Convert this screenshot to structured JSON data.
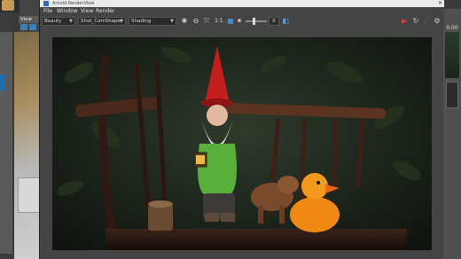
{
  "window": {
    "title": "Arnold RenderView",
    "close_glyph": "✕"
  },
  "side_panel": {
    "tab_label": "View",
    "right_value": "0.00"
  },
  "menu": {
    "items": [
      "File",
      "Window",
      "View",
      "Render"
    ]
  },
  "toolbar": {
    "aov": "Beauty",
    "camera": "Shot_CamShape",
    "mode": "Shading",
    "ratio": "1:1",
    "exposure": "0",
    "icons": {
      "crop": "crop-icon",
      "fit": "fit-icon",
      "refresh": "refresh-icon",
      "settings": "gear-icon",
      "render": "render-icon"
    }
  },
  "colors": {
    "accent": "#2a6fb5",
    "render_stop": "#e33b3b"
  }
}
